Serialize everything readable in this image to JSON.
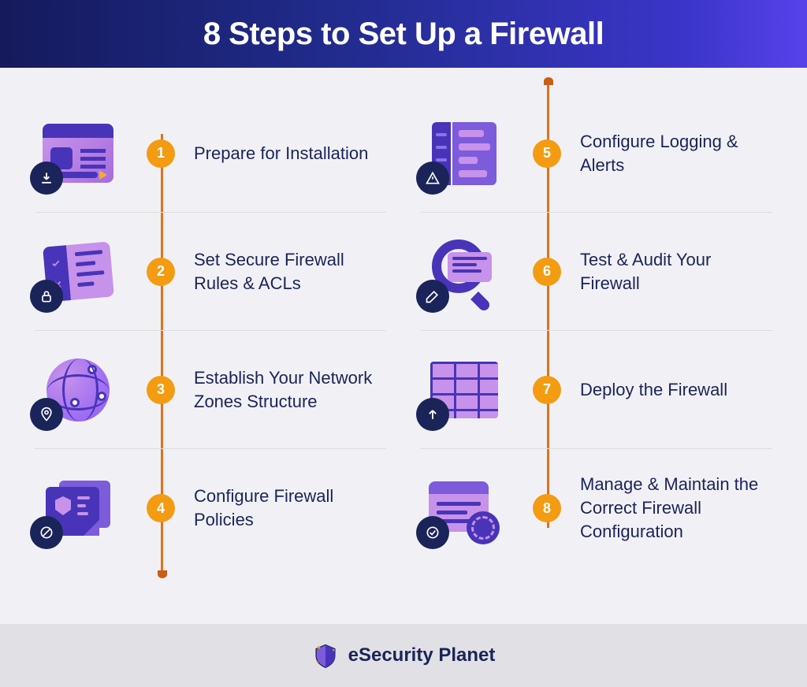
{
  "header": {
    "title": "8 Steps to Set Up a Firewall"
  },
  "steps_left": [
    {
      "number": "1",
      "text": "Prepare for Installation",
      "icon": "browser-gear",
      "badge": "download"
    },
    {
      "number": "2",
      "text": "Set Secure Firewall Rules & ACLs",
      "icon": "checklist",
      "badge": "lock"
    },
    {
      "number": "3",
      "text": "Establish Your Network Zones Structure",
      "icon": "globe",
      "badge": "pin"
    },
    {
      "number": "4",
      "text": "Configure Firewall Policies",
      "icon": "document-shield",
      "badge": "no-entry"
    }
  ],
  "steps_right": [
    {
      "number": "5",
      "text": "Configure Logging & Alerts",
      "icon": "server-panel",
      "badge": "warning"
    },
    {
      "number": "6",
      "text": "Test & Audit Your Firewall",
      "icon": "magnify-note",
      "badge": "pencil"
    },
    {
      "number": "7",
      "text": "Deploy the Firewall",
      "icon": "brick-wall",
      "badge": "arrow-up"
    },
    {
      "number": "8",
      "text": "Manage & Maintain the Correct Firewall Configuration",
      "icon": "gear-window",
      "badge": "check-circle"
    }
  ],
  "footer": {
    "brand": "eSecurity Planet"
  },
  "colors": {
    "primary_dark": "#1a2459",
    "accent_orange": "#f39c12",
    "timeline": "#e2711d",
    "icon_purple": "#c792ea",
    "icon_indigo": "#4834b8"
  }
}
